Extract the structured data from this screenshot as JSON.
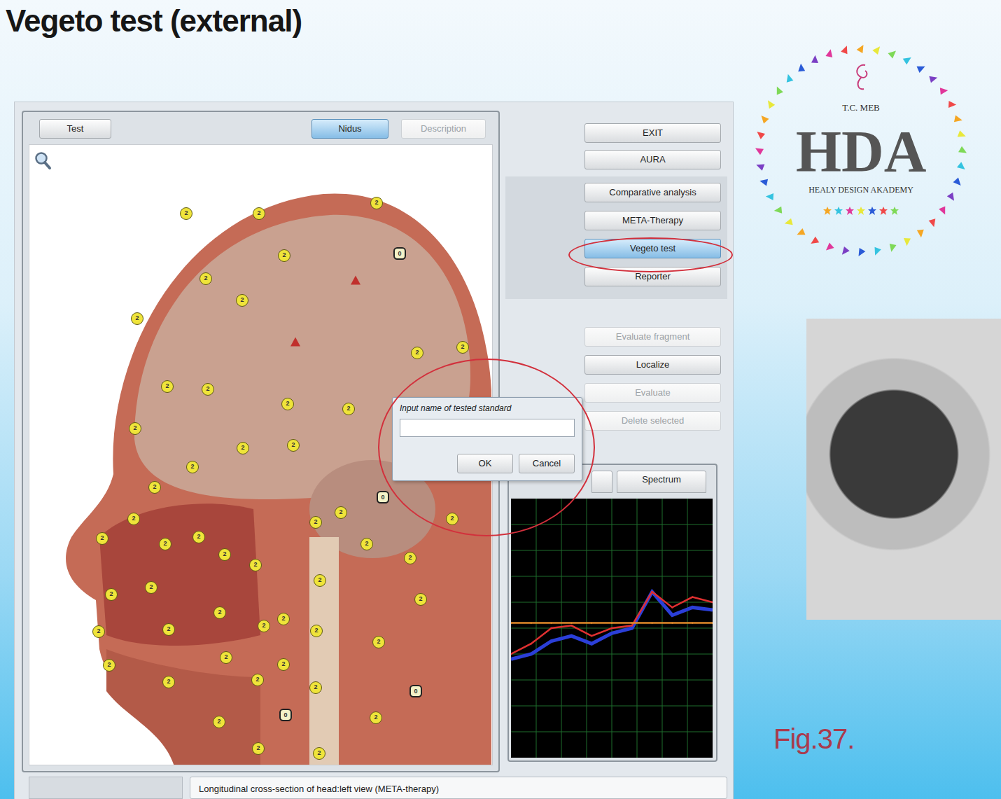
{
  "slide": {
    "title": "Vegeto test (external)",
    "caption": "Fig.37."
  },
  "logo": {
    "top": "T.C. MEB",
    "main": "HDA",
    "sub": "HEALY DESIGN AKADEMY"
  },
  "app": {
    "view_tabs": [
      {
        "label": "Test",
        "selected": false,
        "disabled": false
      },
      {
        "label": "Nidus",
        "selected": true,
        "disabled": false
      },
      {
        "label": "Description",
        "selected": false,
        "disabled": true
      }
    ],
    "markers": [
      {
        "kind": "circle",
        "label": "2"
      },
      {
        "kind": "circle",
        "label": "2"
      },
      {
        "kind": "circle",
        "label": "2"
      },
      {
        "kind": "hex",
        "label": "0"
      },
      {
        "kind": "circle",
        "label": "2"
      },
      {
        "kind": "circle",
        "label": "2"
      },
      {
        "kind": "circle",
        "label": "2"
      },
      {
        "kind": "circle",
        "label": "2"
      },
      {
        "kind": "triangle"
      },
      {
        "kind": "triangle"
      },
      {
        "kind": "circle",
        "label": "2"
      },
      {
        "kind": "circle",
        "label": "2"
      },
      {
        "kind": "circle",
        "label": "2"
      },
      {
        "kind": "circle",
        "label": "2"
      },
      {
        "kind": "circle",
        "label": "2"
      },
      {
        "kind": "circle",
        "label": "2"
      },
      {
        "kind": "circle",
        "label": "2"
      },
      {
        "kind": "circle",
        "label": "2"
      },
      {
        "kind": "circle",
        "label": "2"
      },
      {
        "kind": "circle",
        "label": "2"
      },
      {
        "kind": "circle",
        "label": "2"
      },
      {
        "kind": "hex",
        "label": "0"
      },
      {
        "kind": "circle",
        "label": "2"
      },
      {
        "kind": "circle",
        "label": "2"
      },
      {
        "kind": "circle",
        "label": "2"
      },
      {
        "kind": "circle",
        "label": "2"
      },
      {
        "kind": "circle",
        "label": "2"
      },
      {
        "kind": "circle",
        "label": "2"
      },
      {
        "kind": "circle",
        "label": "2"
      },
      {
        "kind": "circle",
        "label": "2"
      },
      {
        "kind": "circle",
        "label": "2"
      },
      {
        "kind": "circle",
        "label": "2"
      },
      {
        "kind": "circle",
        "label": "2"
      },
      {
        "kind": "circle",
        "label": "2"
      },
      {
        "kind": "circle",
        "label": "2"
      },
      {
        "kind": "circle",
        "label": "2"
      },
      {
        "kind": "circle",
        "label": "2"
      },
      {
        "kind": "circle",
        "label": "2"
      },
      {
        "kind": "circle",
        "label": "2"
      },
      {
        "kind": "circle",
        "label": "2"
      },
      {
        "kind": "circle",
        "label": "2"
      },
      {
        "kind": "circle",
        "label": "2"
      },
      {
        "kind": "circle",
        "label": "2"
      },
      {
        "kind": "circle",
        "label": "2"
      },
      {
        "kind": "circle",
        "label": "2"
      },
      {
        "kind": "circle",
        "label": "2"
      },
      {
        "kind": "circle",
        "label": "2"
      },
      {
        "kind": "circle",
        "label": "2"
      },
      {
        "kind": "circle",
        "label": "2"
      },
      {
        "kind": "circle",
        "label": "2"
      },
      {
        "kind": "hex",
        "label": "0"
      },
      {
        "kind": "hex",
        "label": "0"
      },
      {
        "kind": "circle",
        "label": "2"
      },
      {
        "kind": "circle",
        "label": "2"
      },
      {
        "kind": "circle",
        "label": "2"
      },
      {
        "kind": "circle",
        "label": "2"
      }
    ],
    "menu_buttons": [
      {
        "label": "EXIT",
        "selected": false,
        "disabled": false
      },
      {
        "label": "AURA",
        "selected": false,
        "disabled": false
      }
    ],
    "mode_buttons": [
      {
        "label": "Comparative analysis",
        "selected": false,
        "disabled": false
      },
      {
        "label": "META-Therapy",
        "selected": false,
        "disabled": false
      },
      {
        "label": "Vegeto test",
        "selected": true,
        "disabled": false
      },
      {
        "label": "Reporter",
        "selected": false,
        "disabled": false
      }
    ],
    "tool_buttons": [
      {
        "label": "Evaluate fragment",
        "selected": false,
        "disabled": true
      },
      {
        "label": "Localize",
        "selected": false,
        "disabled": false
      },
      {
        "label": "Evaluate",
        "selected": false,
        "disabled": true
      },
      {
        "label": "Delete selected",
        "selected": false,
        "disabled": true
      }
    ],
    "chart": {
      "tabs": [
        {
          "label": "Spectrum",
          "selected": false
        }
      ],
      "series": [
        {
          "color": "#2b3fd8",
          "values": [
            38,
            40,
            45,
            47,
            44,
            48,
            50,
            64,
            55,
            58,
            57
          ]
        },
        {
          "color": "#e03030",
          "values": [
            40,
            44,
            50,
            51,
            47,
            50,
            51,
            64,
            58,
            62,
            60
          ]
        },
        {
          "color": "#e08a2a",
          "values": [
            52,
            52,
            52,
            52,
            52,
            52,
            52,
            52,
            52,
            52,
            52
          ]
        }
      ]
    },
    "dialog": {
      "title": "Input name of tested standard",
      "value": "",
      "buttons": [
        "OK",
        "Cancel"
      ]
    },
    "status": "Longitudinal cross-section of head:left view (META-therapy)"
  }
}
